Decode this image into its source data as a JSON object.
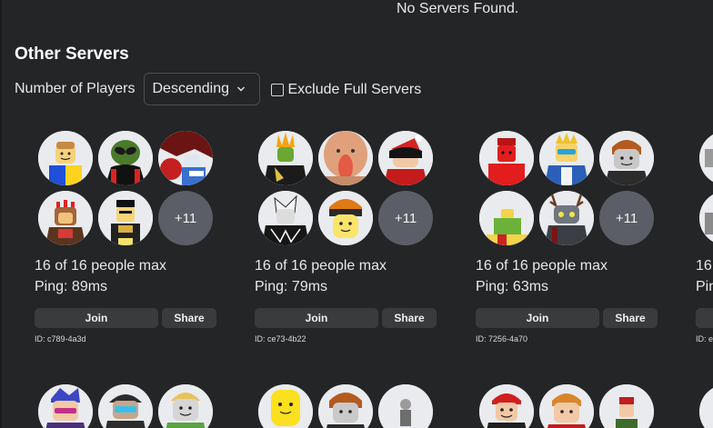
{
  "status": {
    "no_servers": "No Servers Found."
  },
  "section": {
    "title": "Other Servers"
  },
  "controls": {
    "sort_label": "Number of Players",
    "sort_value": "Descending",
    "exclude_label": "Exclude Full Servers",
    "exclude_checked": false
  },
  "servers": [
    {
      "players": "16 of 16 people max",
      "ping": "Ping: 89ms",
      "join": "Join",
      "share": "Share",
      "id": "ID: c789-4a3d",
      "more": "+11"
    },
    {
      "players": "16 of 16 people max",
      "ping": "Ping: 79ms",
      "join": "Join",
      "share": "Share",
      "id": "ID: ce73-4b22",
      "more": "+11"
    },
    {
      "players": "16 of 16 people max",
      "ping": "Ping: 63ms",
      "join": "Join",
      "share": "Share",
      "id": "ID: 7256-4a70",
      "more": "+11"
    },
    {
      "players": "16",
      "ping": "Pin",
      "id": "ID: e"
    }
  ],
  "colors": {
    "background": "#232527",
    "button": "#393b3d",
    "badge": "#5b5e66",
    "avatar_bg": "#e9ebee"
  }
}
